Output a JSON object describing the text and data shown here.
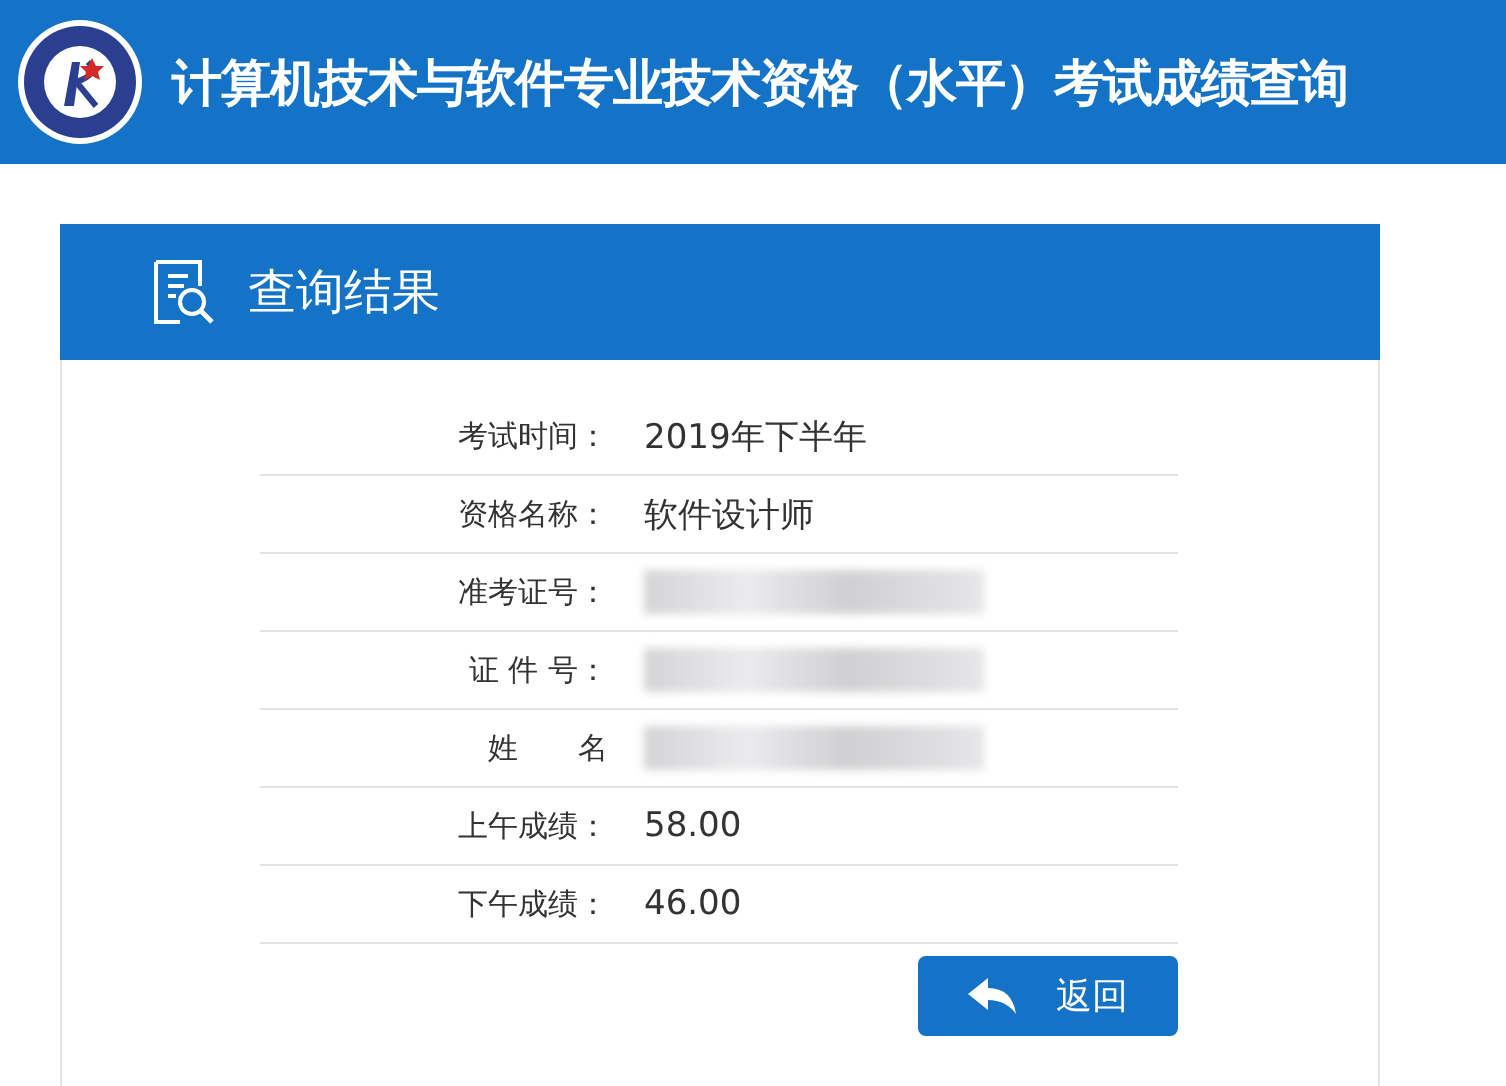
{
  "header": {
    "title": "计算机技术与软件专业技术资格（水平）考试成绩查询"
  },
  "panel": {
    "title": "查询结果"
  },
  "rows": [
    {
      "label": "考试时间：",
      "value": "2019年下半年",
      "redacted": false
    },
    {
      "label": "资格名称：",
      "value": "软件设计师",
      "redacted": false
    },
    {
      "label": "准考证号：",
      "redacted": true
    },
    {
      "label": "证 件 号：",
      "redacted": true
    },
    {
      "label": "姓　　名",
      "redacted": true
    },
    {
      "label": "上午成绩：",
      "value": "58.00",
      "redacted": false
    },
    {
      "label": "下午成绩：",
      "value": "46.00",
      "redacted": false
    }
  ],
  "back_button": {
    "label": "返回"
  }
}
